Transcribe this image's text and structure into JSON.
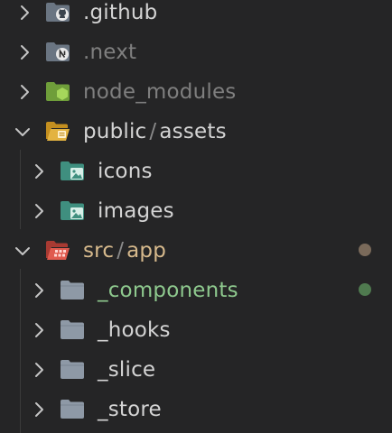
{
  "tree": {
    "items": [
      {
        "label": ".github",
        "color": "#d4d4d4",
        "icon": "github-folder-icon",
        "expanded": false
      },
      {
        "label": ".next",
        "color": "#7f7f7f",
        "icon": "next-folder-icon",
        "expanded": false
      },
      {
        "label": "node_modules",
        "color": "#7f7f7f",
        "icon": "node-folder-icon",
        "expanded": false
      },
      {
        "label": "public",
        "label_rest": "assets",
        "separator": "/",
        "color": "#d4d4d4",
        "icon": "public-open-folder-icon",
        "expanded": true
      },
      {
        "label": "icons",
        "color": "#d4d4d4",
        "icon": "image-folder-icon",
        "expanded": false
      },
      {
        "label": "images",
        "color": "#d4d4d4",
        "icon": "image-folder-icon",
        "expanded": false
      },
      {
        "label": "src",
        "label_rest": "app",
        "separator": "/",
        "color": "#d6b98c",
        "icon": "src-open-folder-icon",
        "expanded": true,
        "badge_color": "#7a6a5a"
      },
      {
        "label": "_components",
        "color": "#8ec98e",
        "icon": "folder-icon",
        "expanded": false,
        "badge_color": "#4f7a4f"
      },
      {
        "label": "_hooks",
        "color": "#d4d4d4",
        "icon": "folder-icon",
        "expanded": false
      },
      {
        "label": "_slice",
        "color": "#d4d4d4",
        "icon": "folder-icon",
        "expanded": false
      },
      {
        "label": "_store",
        "color": "#d4d4d4",
        "icon": "folder-icon",
        "expanded": false
      }
    ]
  },
  "colors": {
    "background": "#252526",
    "chevron": "#c5c5c5",
    "indent_guide": "#3a3a3a",
    "folder_gray": "#8e99a6",
    "folder_teal": "#3f8f7f",
    "folder_green": "#8bc34a",
    "folder_yellow": "#e3b341",
    "folder_red": "#e05a4e"
  }
}
